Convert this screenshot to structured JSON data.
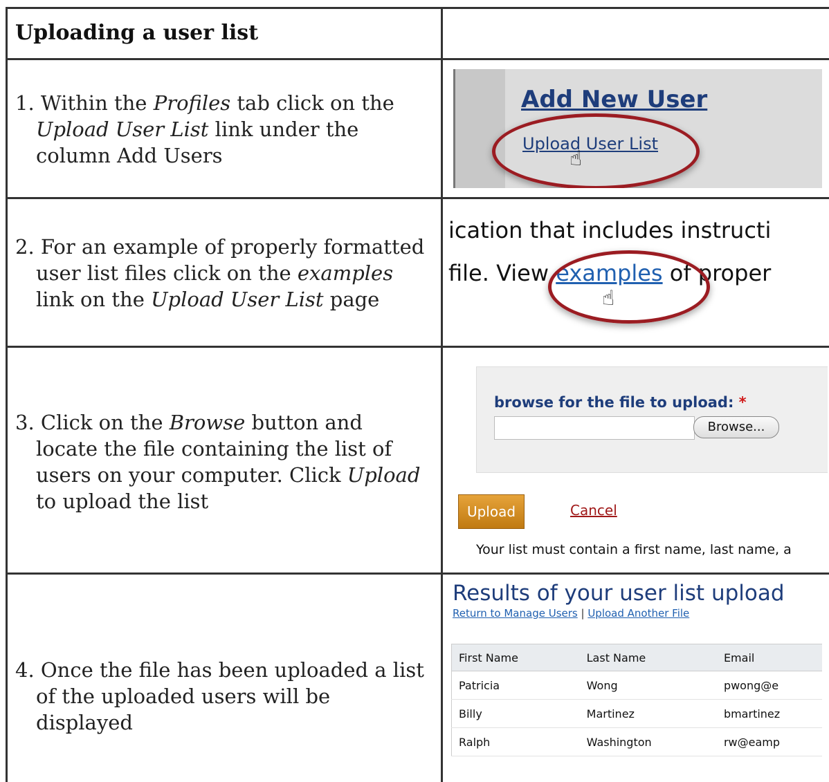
{
  "title": "Uploading a user list",
  "steps": [
    {
      "num": "1.",
      "parts": [
        "Within the ",
        "Profiles",
        " tab click on the ",
        "Upload User List",
        " link under the column Add Users"
      ]
    },
    {
      "num": "2.",
      "parts": [
        "For an example of properly formatted user list files click on the ",
        "examples",
        " link on the ",
        "Upload User List",
        " page"
      ]
    },
    {
      "num": "3.",
      "parts": [
        "Click on the ",
        "Browse",
        " button and locate the file containing the list of users on your computer. Click ",
        "Upload",
        " to upload the list"
      ]
    },
    {
      "num": "4.",
      "parts": [
        "Once the file has been uploaded a list of the uploaded users will be displayed"
      ]
    }
  ],
  "shot1": {
    "add_new_user": "Add New User",
    "upload_user_list": "Upload User List"
  },
  "shot2": {
    "line1": "ication that includes instructi",
    "line2_pre": "file. View ",
    "line2_link": "examples",
    "line2_post": " of proper"
  },
  "shot3": {
    "label": "browse for the file to upload:",
    "required_mark": "*",
    "browse_button": "Browse...",
    "upload_button": "Upload",
    "cancel_link": "Cancel",
    "note": "Your list must contain a first name, last name, a"
  },
  "shot4": {
    "heading": "Results of your user list upload",
    "link_return": "Return to Manage Users",
    "separator": " | ",
    "link_another": "Upload Another File",
    "columns": [
      "First Name",
      "Last Name",
      "Email"
    ],
    "rows": [
      [
        "Patricia",
        "Wong",
        "pwong@e"
      ],
      [
        "Billy",
        "Martinez",
        "bmartinez"
      ],
      [
        "Ralph",
        "Washington",
        "rw@eamp"
      ]
    ]
  }
}
